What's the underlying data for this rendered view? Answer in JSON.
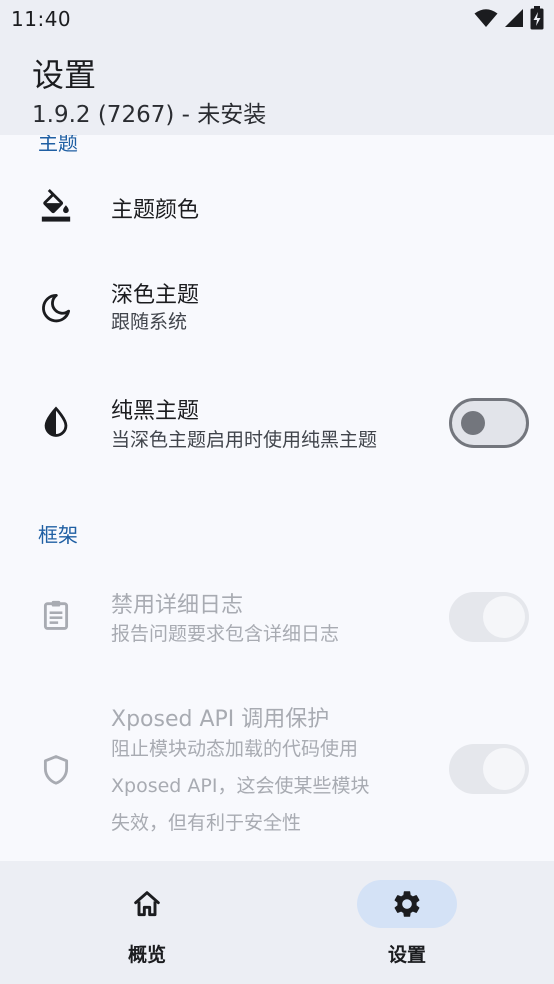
{
  "status_bar": {
    "time": "11:40",
    "icons": [
      "wifi-icon",
      "signal-icon",
      "battery-charging-icon"
    ]
  },
  "app_bar": {
    "title": "设置",
    "subtitle": "1.9.2 (7267) - 未安装"
  },
  "sections": [
    {
      "header": "主题",
      "items": [
        {
          "icon": "format-color-fill-icon",
          "title": "主题颜色"
        },
        {
          "icon": "dark-mode-moon-icon",
          "title": "深色主题",
          "summary": "跟随系统"
        },
        {
          "icon": "contrast-drop-icon",
          "title": "纯黑主题",
          "summary": "当深色主题启用时使用纯黑主题",
          "switch_on": false
        }
      ]
    },
    {
      "header": "框架",
      "items": [
        {
          "icon": "assignment-log-icon",
          "title": "禁用详细日志",
          "summary": "报告问题要求包含详细日志",
          "switch_on": true,
          "disabled": true
        },
        {
          "icon": "shield-icon",
          "title": "Xposed API 调用保护",
          "summary_lines": [
            "阻止模块动态加载的代码使用",
            "Xposed API，这会使某些模块",
            "失效，但有利于安全性"
          ],
          "switch_on": true,
          "disabled": true
        }
      ]
    }
  ],
  "bottom_nav": {
    "items": [
      {
        "icon": "home-icon",
        "label": "概览",
        "active": false
      },
      {
        "icon": "settings-gear-icon",
        "label": "设置",
        "active": true
      }
    ]
  },
  "colors": {
    "accent": "#1f5fa3",
    "nav_indicator": "#d4e2f6",
    "surface": "#eceef4",
    "background": "#f8f9fd"
  }
}
